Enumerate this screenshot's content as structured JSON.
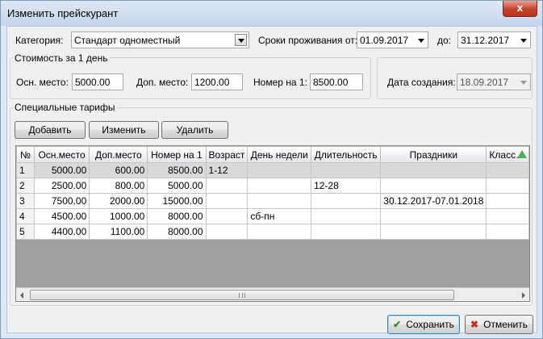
{
  "window": {
    "title": "Изменить прейскурант",
    "close_glyph": "x"
  },
  "category": {
    "label": "Категория:",
    "value": "Стандарт одноместный"
  },
  "stay_period": {
    "from_label": "Сроки проживания от:",
    "from_value": "01.09.2017",
    "to_label": "до:",
    "to_value": "31.12.2017"
  },
  "cost_group": {
    "title": "Стоимость за 1 день",
    "main_label": "Осн. место:",
    "main_value": "5000.00",
    "extra_label": "Доп. место:",
    "extra_value": "1200.00",
    "room_label": "Номер на 1:",
    "room_value": "8500.00"
  },
  "creation": {
    "label": "Дата создания:",
    "value": "18.09.2017"
  },
  "special": {
    "title": "Специальные тарифы",
    "add_label": "Добавить",
    "edit_label": "Изменить",
    "delete_label": "Удалить"
  },
  "table": {
    "columns": [
      "№",
      "Осн.место",
      "Доп.место",
      "Номер на 1",
      "Возраст",
      "День недели",
      "Длительность",
      "Праздники",
      "Класс…"
    ],
    "rows": [
      [
        "1",
        "5000.00",
        "600.00",
        "8500.00",
        "1-12",
        "",
        "",
        "",
        ""
      ],
      [
        "2",
        "2500.00",
        "800.00",
        "5000.00",
        "",
        "",
        "12-28",
        "",
        ""
      ],
      [
        "3",
        "7500.00",
        "2000.00",
        "15000.00",
        "",
        "",
        "",
        "30.12.2017-07.01.2018",
        ""
      ],
      [
        "4",
        "4500.00",
        "1000.00",
        "8000.00",
        "",
        "сб-пн",
        "",
        "",
        ""
      ],
      [
        "5",
        "4400.00",
        "1100.00",
        "8000.00",
        "",
        "",
        "",
        "",
        ""
      ]
    ],
    "selected_row": 1
  },
  "footer": {
    "save_label": "Сохранить",
    "cancel_label": "Отменить"
  },
  "colors": {
    "accent": "#3c7fb1",
    "selected_row": "#d9d9d9",
    "grid_empty": "#a0a0a0"
  }
}
